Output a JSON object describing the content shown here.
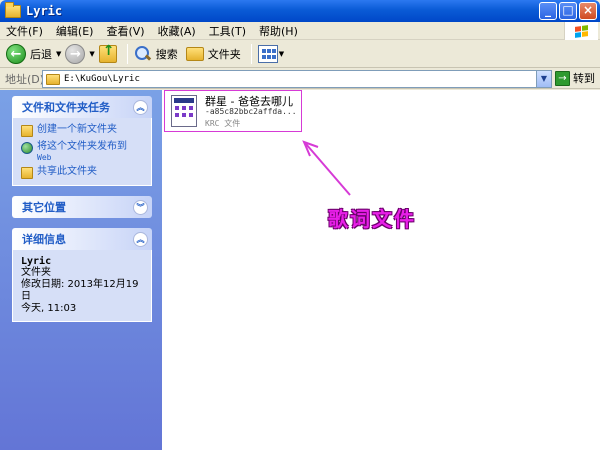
{
  "window": {
    "title": "Lyric"
  },
  "menubar": {
    "items": [
      "文件(F)",
      "编辑(E)",
      "查看(V)",
      "收藏(A)",
      "工具(T)",
      "帮助(H)"
    ]
  },
  "toolbar": {
    "back_label": "后退",
    "search_label": "搜索",
    "folders_label": "文件夹"
  },
  "address": {
    "label": "地址(D)",
    "path": "E:\\KuGou\\Lyric",
    "go_label": "转到"
  },
  "sidebar": {
    "tasks": {
      "title": "文件和文件夹任务",
      "items": [
        {
          "label": "创建一个新文件夹",
          "sub": ""
        },
        {
          "label": "将这个文件夹发布到",
          "sub": "Web"
        },
        {
          "label": "共享此文件夹",
          "sub": ""
        }
      ]
    },
    "other_places": {
      "title": "其它位置"
    },
    "details": {
      "title": "详细信息",
      "name": "Lyric",
      "type": "文件夹",
      "modified_line1": "修改日期: 2013年12月19日",
      "modified_line2": "今天, 11:03"
    }
  },
  "files": [
    {
      "name": "群星 - 爸爸去哪儿",
      "hash": "-a85c82bbc2affda...",
      "type": "KRC 文件"
    }
  ],
  "annotation": {
    "text": "歌词文件",
    "color": "#e81fe8"
  },
  "colors": {
    "title_bar": "#0a5bd6",
    "sidebar_bg": "#7aa1e6",
    "sidebar_link": "#215dc6",
    "selection_border": "#d63ad6"
  }
}
